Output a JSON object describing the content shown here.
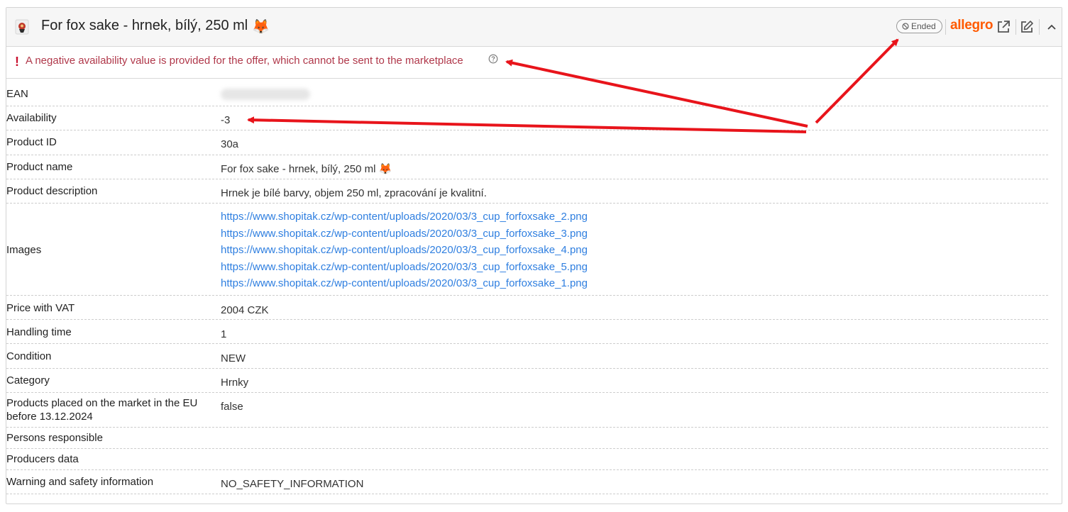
{
  "header": {
    "title": "For fox sake - hrnek, bílý, 250 ml",
    "title_emoji": "🦊",
    "status": "Ended",
    "marketplace": "allegro",
    "accent_color": "#ff5a00"
  },
  "warning": {
    "mark": "❗",
    "text": "A negative availability value is provided for the offer, which cannot be sent to the marketplace",
    "color": "#c8102e"
  },
  "icons": {
    "product_thumb": "product-image-icon",
    "status": "ban-icon",
    "open": "external-link-icon",
    "edit": "edit-icon",
    "collapse": "chevron-up-icon",
    "help": "help-circle-icon"
  },
  "details": {
    "ean": {
      "label": "EAN",
      "value": ""
    },
    "availability": {
      "label": "Availability",
      "value": "-3"
    },
    "product_id": {
      "label": "Product ID",
      "value": "30a"
    },
    "product_name": {
      "label": "Product name",
      "value": "For fox sake - hrnek, bílý, 250 ml",
      "emoji": "🦊"
    },
    "product_description": {
      "label": "Product description",
      "value": "Hrnek je bílé barvy, objem 250 ml, zpracování je kvalitní."
    },
    "images": {
      "label": "Images",
      "links": [
        "https://www.shopitak.cz/wp-content/uploads/2020/03/3_cup_forfoxsake_2.png",
        "https://www.shopitak.cz/wp-content/uploads/2020/03/3_cup_forfoxsake_3.png",
        "https://www.shopitak.cz/wp-content/uploads/2020/03/3_cup_forfoxsake_4.png",
        "https://www.shopitak.cz/wp-content/uploads/2020/03/3_cup_forfoxsake_5.png",
        "https://www.shopitak.cz/wp-content/uploads/2020/03/3_cup_forfoxsake_1.png"
      ]
    },
    "price": {
      "label": "Price with VAT",
      "value": "2004 CZK"
    },
    "handling_time": {
      "label": "Handling time",
      "value": "1"
    },
    "condition": {
      "label": "Condition",
      "value": "NEW"
    },
    "category": {
      "label": "Category",
      "value": "Hrnky"
    },
    "eu_market": {
      "label": "Products placed on the market in the EU before 13.12.2024",
      "value": "false"
    },
    "persons_responsible": {
      "label": "Persons responsible",
      "value": ""
    },
    "producers_data": {
      "label": "Producers data",
      "value": ""
    },
    "safety_info": {
      "label": "Warning and safety information",
      "value": "NO_SAFETY_INFORMATION"
    }
  },
  "annotation_color": "#e8141b"
}
